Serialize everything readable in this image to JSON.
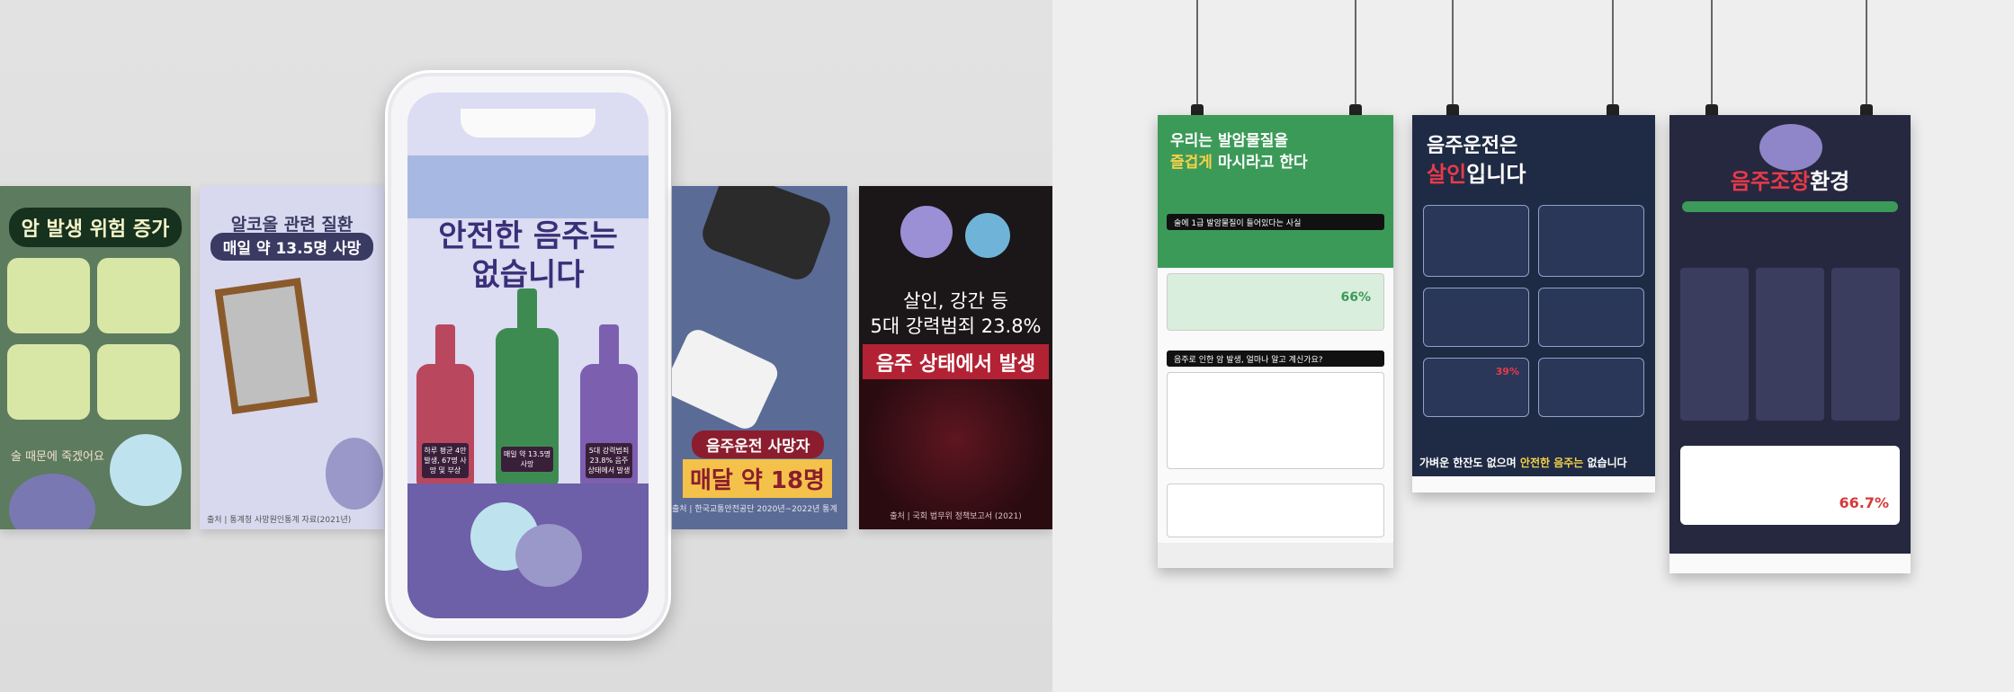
{
  "left_cards": {
    "card1": {
      "title": "암 발생 위험 증가",
      "footer": "술 때문에 죽겠어요"
    },
    "card2": {
      "line1": "알코올 관련 질환",
      "line2": "매일 약 13.5명 사망",
      "source": "출처 | 통계청 사망원인통계 자료(2021년)"
    },
    "phone": {
      "title_line1": "안전한 음주는",
      "title_line2": "없습니다",
      "bottles": [
        {
          "label": "하루 평균 4만 발생, 67명 사망 및 부상"
        },
        {
          "label": "매일 약 13.5명 사망"
        },
        {
          "label": "5대 강력범죄 23.8% 음주상태에서 발생"
        }
      ]
    },
    "card3": {
      "badge": "음주운전 사망자",
      "big": "매달 약 18명",
      "source": "출처 | 한국교통안전공단 2020년~2022년 통계"
    },
    "card4": {
      "line1": "살인, 강간 등",
      "line2": "5대 강력범죄 23.8%",
      "line3": "음주 상태에서 발생",
      "source": "출처 | 국회 법무위 정책보고서 (2021)"
    }
  },
  "posters": {
    "p1": {
      "title_line1": "우리는 발암물질을",
      "title_highlight": "즐겁게",
      "title_rest": " 마시라고 한다",
      "strip1": "술에 1급 발암물질이 들어있다는 사실",
      "strip2": "음주로 인한 암 발생, 얼마나 알고 계신가요?",
      "percent": "66%"
    },
    "p2": {
      "title_line1": "음주운전은",
      "title_highlight": "살인",
      "title_rest": "입니다",
      "footer_pre": "가벼운 한잔도 없으며 ",
      "footer_highlight": "안전한 음주는",
      "footer_post": " 없습니다",
      "stat1": "39%"
    },
    "p3": {
      "title_red": "음주조장",
      "title_white": "환경",
      "percent": "66.7%"
    }
  }
}
